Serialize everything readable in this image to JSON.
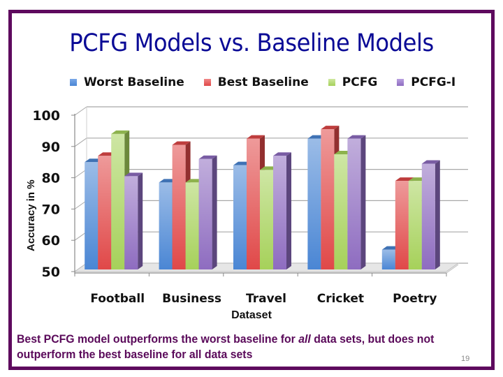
{
  "slide": {
    "title": "PCFG Models vs. Baseline Models",
    "footer_part1": "Best PCFG model outperforms the worst baseline for ",
    "footer_emphasis": "all",
    "footer_part2": " data sets, but does not outperform the best baseline for all data sets",
    "page_number": "19",
    "colors": {
      "border": "#5e0a5e",
      "title": "#0a0a96",
      "footer": "#5a0a5a"
    }
  },
  "chart_data": {
    "type": "bar",
    "style": "3d-clustered-column",
    "title": "",
    "xlabel": "Dataset",
    "ylabel": "Accuracy in %",
    "ylim": [
      50,
      100
    ],
    "yticks": [
      50,
      60,
      70,
      80,
      90,
      100
    ],
    "grid": true,
    "legend_position": "top",
    "categories": [
      "Football",
      "Business",
      "Travel",
      "Cricket",
      "Poetry"
    ],
    "series": [
      {
        "name": "Worst Baseline",
        "color": "#4a86d4",
        "values": [
          85,
          78.5,
          84,
          92.5,
          57
        ]
      },
      {
        "name": "Best Baseline",
        "color": "#e04848",
        "values": [
          87,
          90.5,
          92.5,
          95.5,
          79
        ]
      },
      {
        "name": "PCFG",
        "color": "#a6d15a",
        "values": [
          94,
          78.5,
          82.5,
          87.5,
          79
        ]
      },
      {
        "name": "PCFG-I",
        "color": "#8e6cc0",
        "values": [
          80.5,
          86,
          87,
          92.5,
          84.5
        ]
      }
    ]
  }
}
